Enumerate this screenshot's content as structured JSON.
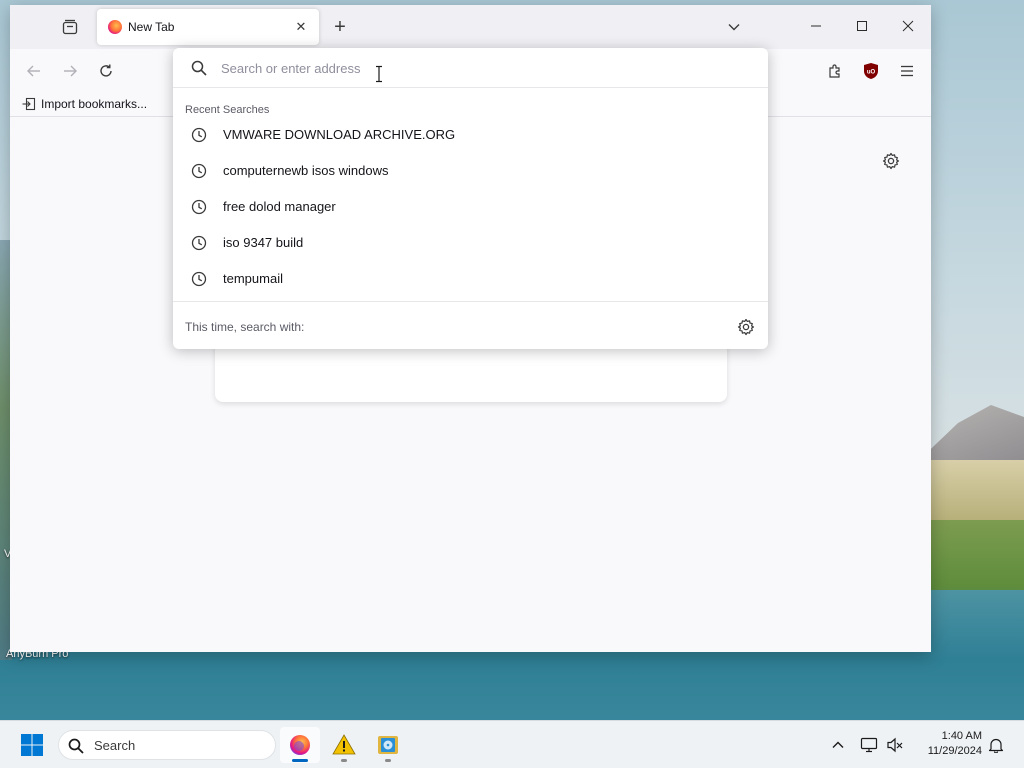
{
  "desktop": {
    "icon_label": "AnyBurn Pro",
    "partial_label": "V"
  },
  "browser": {
    "tab": {
      "title": "New Tab",
      "close_symbol": "✕"
    },
    "new_tab_symbol": "+",
    "bookmarks": {
      "import_label": "Import bookmarks..."
    },
    "urlbar": {
      "placeholder": "Search or enter address",
      "value": "",
      "recent_header": "Recent Searches",
      "recent_searches": [
        "VMWARE DOWNLOAD ARCHIVE.ORG",
        "computernewb isos windows",
        "free dolod manager",
        "iso 9347 build",
        "tempumail"
      ],
      "footer_text": "This time, search with:"
    },
    "icons": {
      "back": "arrow-left-icon",
      "forward": "arrow-right-icon",
      "reload": "reload-icon",
      "extensions": "puzzle-icon",
      "ublock": "ublock-shield-icon",
      "menu": "hamburger-icon"
    },
    "ublock_color": "#800000",
    "accent": "#0061e0"
  },
  "taskbar": {
    "search_label": "Search",
    "clock": {
      "time": "1:40 AM",
      "date": "11/29/2024"
    },
    "accent": "#0067c0"
  }
}
